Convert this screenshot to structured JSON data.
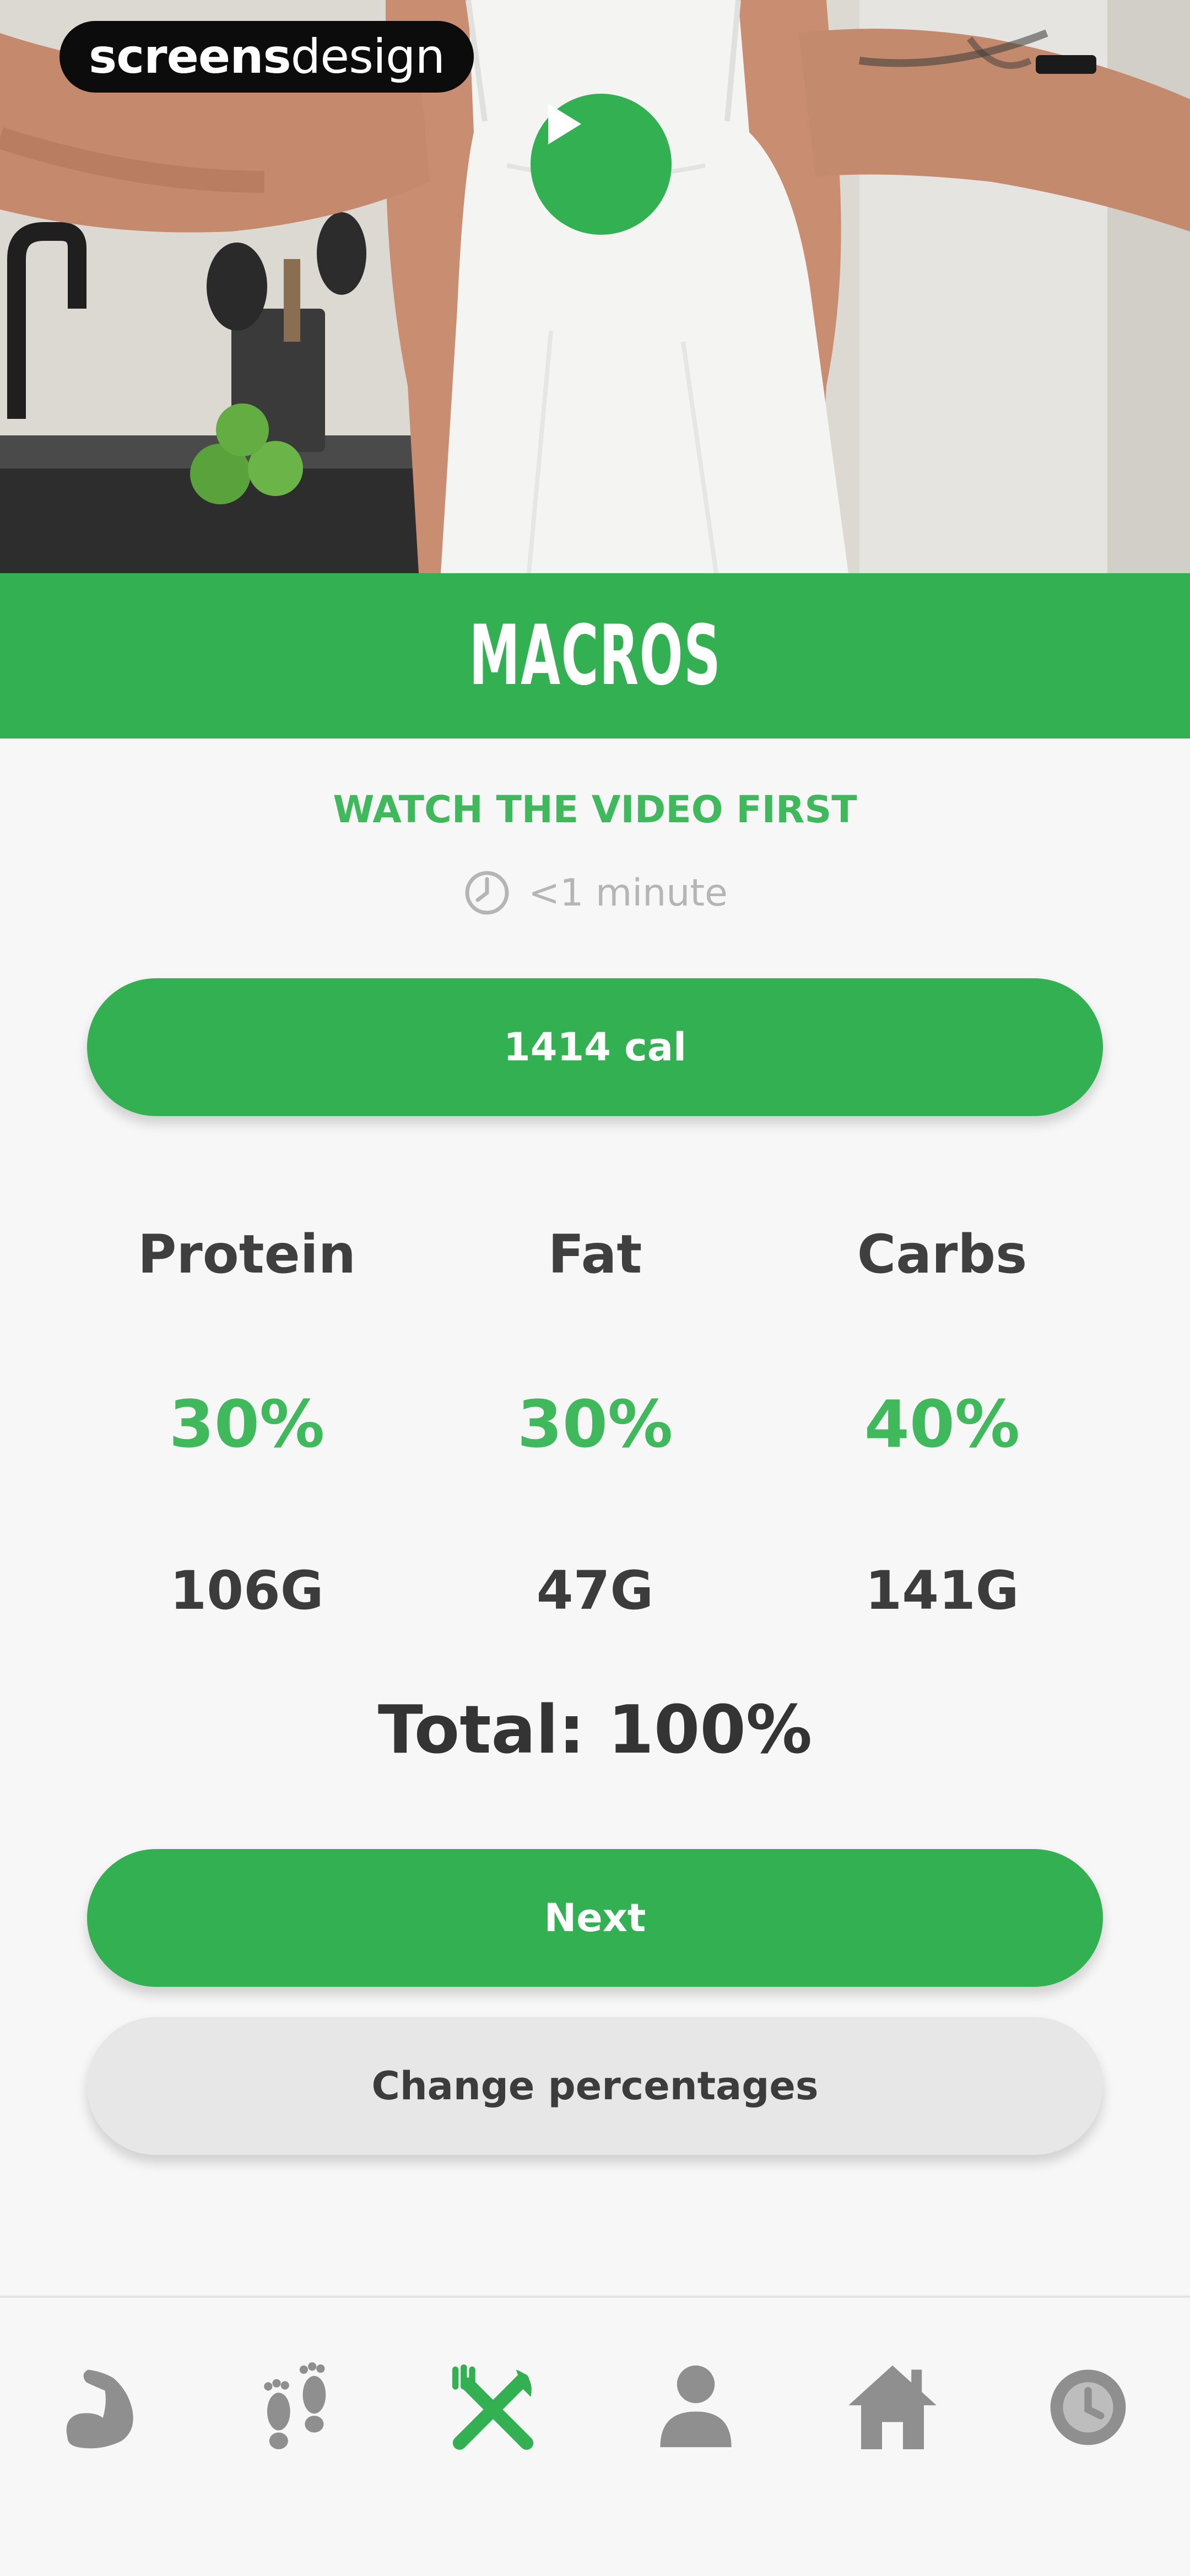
{
  "branding": {
    "logo_bold": "screens",
    "logo_light": "design"
  },
  "hero": {
    "video_state": "paused",
    "play_icon": "play-icon"
  },
  "banner": {
    "title": "MACROS"
  },
  "video_prompt": {
    "title": "WATCH THE VIDEO FIRST",
    "duration": "<1 minute",
    "duration_icon": "clock-icon"
  },
  "calories": {
    "label": "1414 cal"
  },
  "macros": [
    {
      "name": "Protein",
      "percent": "30%",
      "grams": "106G"
    },
    {
      "name": "Fat",
      "percent": "30%",
      "grams": "47G"
    },
    {
      "name": "Carbs",
      "percent": "40%",
      "grams": "141G"
    }
  ],
  "total": "Total: 100%",
  "actions": {
    "next": "Next",
    "change": "Change percentages"
  },
  "bottom_nav": {
    "items": [
      {
        "icon": "bicep-icon",
        "active": false
      },
      {
        "icon": "footsteps-icon",
        "active": false
      },
      {
        "icon": "fork-knife-cross-icon",
        "active": true
      },
      {
        "icon": "person-icon",
        "active": false
      },
      {
        "icon": "home-icon",
        "active": false
      },
      {
        "icon": "clock-icon",
        "active": false
      }
    ]
  },
  "colors": {
    "accent": "#33b152",
    "accent_text": "#3fb95c",
    "inactive_icon": "#8f8f8f",
    "background": "#f7f7f7"
  }
}
